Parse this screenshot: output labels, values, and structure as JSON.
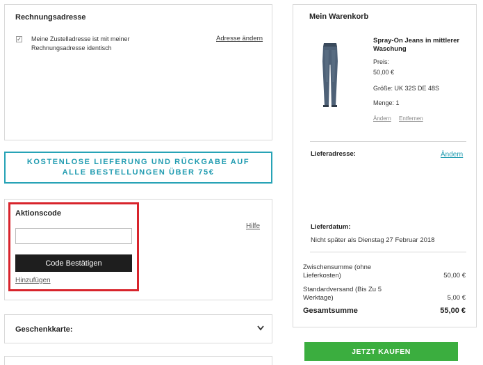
{
  "billing": {
    "title": "Rechnungsadresse",
    "same_address_text": "Meine Zustelladresse ist mit meiner Rechnungsadresse identisch",
    "same_address_checked": true,
    "change_link": "Adresse ändern"
  },
  "promo_banner": {
    "text": "KOSTENLOSE LIEFERUNG UND RÜCKGABE AUF ALLE BESTELLUNGEN ÜBER 75€"
  },
  "promo_code": {
    "title": "Aktionscode",
    "input_value": "",
    "apply_button": "Code Bestätigen",
    "add_link": "Hinzufügen",
    "help_link": "Hilfe"
  },
  "gift_card": {
    "title": "Geschenkkarte:"
  },
  "cart": {
    "title": "Mein Warenkorb",
    "item": {
      "name": "Spray-On Jeans in mittlerer Waschung",
      "price_label": "Preis:",
      "price": "50,00 €",
      "size": "Größe: UK 32S DE 48S",
      "quantity": "Menge: 1",
      "edit_link": "Ändern",
      "remove_link": "Entfernen"
    },
    "shipping_address_label": "Lieferadresse:",
    "shipping_address_change": "Ändern",
    "delivery_date_label": "Lieferdatum:",
    "delivery_date_value": "Nicht später als Dienstag 27 Februar 2018",
    "subtotal_label": "Zwischensumme (ohne Lieferkosten)",
    "subtotal_value": "50,00 €",
    "shipping_label": "Standardversand (Bis Zu 5 Werktage)",
    "shipping_value": "5,00 €",
    "total_label": "Gesamtsumme",
    "total_value": "55,00 €"
  },
  "checkout": {
    "buy_button": "JETZT KAUFEN"
  },
  "colors": {
    "accent_teal": "#27a3b6",
    "highlight_red": "#d8242c",
    "buy_green": "#3bae3f",
    "button_dark": "#1e1e1e"
  }
}
